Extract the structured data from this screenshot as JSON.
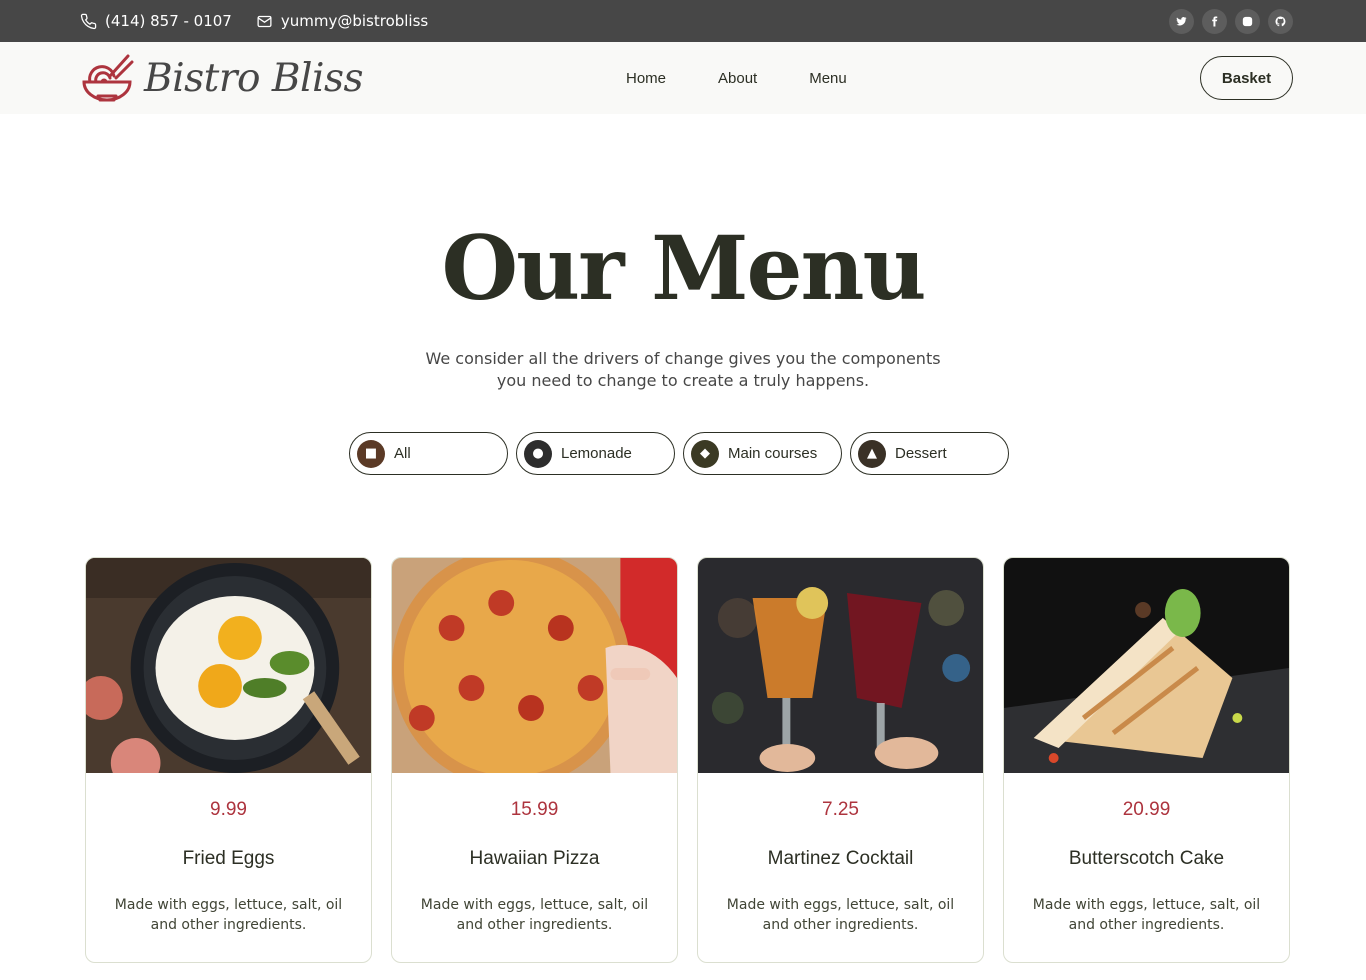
{
  "topbar": {
    "phone": "(414) 857 - 0107",
    "email": "yummy@bistrobliss",
    "socials": [
      "twitter-icon",
      "facebook-icon",
      "instagram-icon",
      "github-icon"
    ]
  },
  "header": {
    "brand": "Bistro Bliss",
    "nav": [
      "Home",
      "About",
      "Menu"
    ],
    "basket": "Basket"
  },
  "hero": {
    "title": "Our Menu",
    "subtitle": "We consider all the drivers of change gives you the components you need to change to create a truly happens."
  },
  "filters": [
    {
      "label": "All"
    },
    {
      "label": "Lemonade"
    },
    {
      "label": "Main courses"
    },
    {
      "label": "Dessert"
    }
  ],
  "items": [
    {
      "price": "9.99",
      "name": "Fried Eggs",
      "desc": "Made with eggs, lettuce, salt, oil and other ingredients."
    },
    {
      "price": "15.99",
      "name": "Hawaiian Pizza",
      "desc": "Made with eggs, lettuce, salt, oil and other ingredients."
    },
    {
      "price": "7.25",
      "name": "Martinez Cocktail",
      "desc": "Made with eggs, lettuce, salt, oil and other ingredients."
    },
    {
      "price": "20.99",
      "name": "Butterscotch Cake",
      "desc": "Made with eggs, lettuce, salt, oil and other ingredients."
    }
  ],
  "colors": {
    "accent": "#ad343e",
    "dark": "#2c2f24",
    "topbar": "#474747"
  }
}
